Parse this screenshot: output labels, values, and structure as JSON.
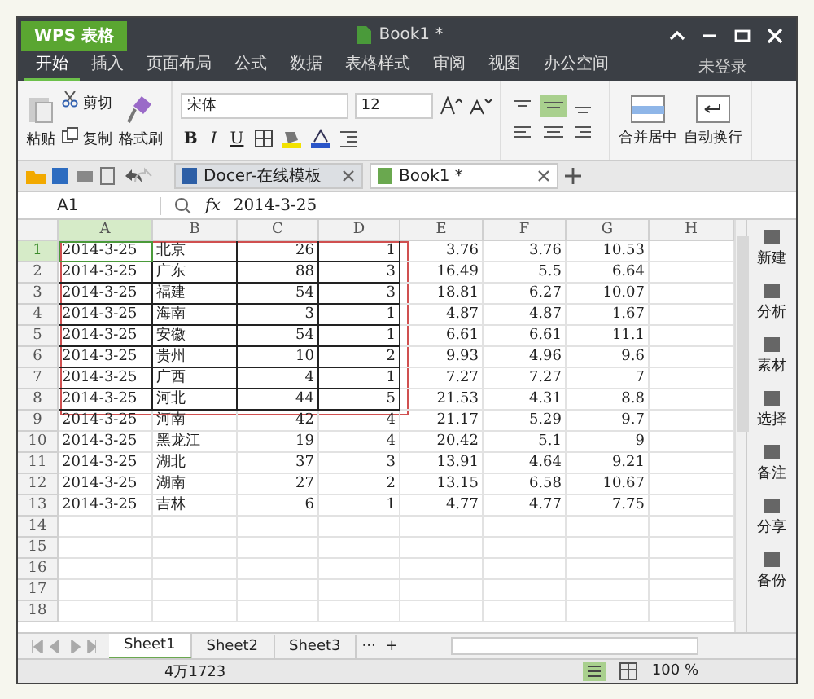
{
  "window": {
    "app_button": "WPS 表格",
    "title": "Book1 *"
  },
  "menu": [
    {
      "label": "开始",
      "selected": true
    },
    {
      "label": "插入",
      "selected": false
    },
    {
      "label": "页面布局",
      "selected": false
    },
    {
      "label": "公式",
      "selected": false
    },
    {
      "label": "数据",
      "selected": false
    },
    {
      "label": "表格样式",
      "selected": false
    },
    {
      "label": "审阅",
      "selected": false
    },
    {
      "label": "视图",
      "selected": false
    },
    {
      "label": "办公空间",
      "selected": false
    }
  ],
  "login": "未登录",
  "ribbon": {
    "paste": "粘贴",
    "cut": "剪切",
    "copy": "复制",
    "format_painter": "格式刷",
    "font": "宋体",
    "size": "12",
    "bold": "B",
    "italic": "I",
    "underline": "U",
    "merge": "合并居中",
    "wrap": "自动换行"
  },
  "doc_tabs": [
    {
      "label": "Docer-在线模板",
      "selected": false
    },
    {
      "label": "Book1 *",
      "selected": true
    }
  ],
  "formula_bar": {
    "cell_ref": "A1",
    "fx": "fx",
    "value": "2014-3-25"
  },
  "columns": [
    {
      "label": "A",
      "selected": true
    },
    {
      "label": "B",
      "selected": false
    },
    {
      "label": "C",
      "selected": false
    },
    {
      "label": "D",
      "selected": false
    },
    {
      "label": "E",
      "selected": false
    },
    {
      "label": "F",
      "selected": false
    },
    {
      "label": "G",
      "selected": false
    },
    {
      "label": "H",
      "selected": false
    }
  ],
  "rows": [
    {
      "num": "1",
      "selected": true,
      "bordered": true,
      "cells": [
        "2014-3-25",
        "北京",
        "26",
        "1",
        "3.76",
        "3.76",
        "10.53"
      ]
    },
    {
      "num": "2",
      "selected": false,
      "bordered": true,
      "cells": [
        "2014-3-25",
        "广东",
        "88",
        "3",
        "16.49",
        "5.5",
        "6.64"
      ]
    },
    {
      "num": "3",
      "selected": false,
      "bordered": true,
      "cells": [
        "2014-3-25",
        "福建",
        "54",
        "3",
        "18.81",
        "6.27",
        "10.07"
      ]
    },
    {
      "num": "4",
      "selected": false,
      "bordered": true,
      "cells": [
        "2014-3-25",
        "海南",
        "3",
        "1",
        "4.87",
        "4.87",
        "1.67"
      ]
    },
    {
      "num": "5",
      "selected": false,
      "bordered": true,
      "cells": [
        "2014-3-25",
        "安徽",
        "54",
        "1",
        "6.61",
        "6.61",
        "11.1"
      ]
    },
    {
      "num": "6",
      "selected": false,
      "bordered": true,
      "cells": [
        "2014-3-25",
        "贵州",
        "10",
        "2",
        "9.93",
        "4.96",
        "9.6"
      ]
    },
    {
      "num": "7",
      "selected": false,
      "bordered": true,
      "cells": [
        "2014-3-25",
        "广西",
        "4",
        "1",
        "7.27",
        "7.27",
        "7"
      ]
    },
    {
      "num": "8",
      "selected": false,
      "bordered": true,
      "cells": [
        "2014-3-25",
        "河北",
        "44",
        "5",
        "21.53",
        "4.31",
        "8.8"
      ]
    },
    {
      "num": "9",
      "selected": false,
      "bordered": false,
      "cells": [
        "2014-3-25",
        "河南",
        "42",
        "4",
        "21.17",
        "5.29",
        "9.7"
      ]
    },
    {
      "num": "10",
      "selected": false,
      "bordered": false,
      "cells": [
        "2014-3-25",
        "黑龙江",
        "19",
        "4",
        "20.42",
        "5.1",
        "9"
      ]
    },
    {
      "num": "11",
      "selected": false,
      "bordered": false,
      "cells": [
        "2014-3-25",
        "湖北",
        "37",
        "3",
        "13.91",
        "4.64",
        "9.21"
      ]
    },
    {
      "num": "12",
      "selected": false,
      "bordered": false,
      "cells": [
        "2014-3-25",
        "湖南",
        "27",
        "2",
        "13.15",
        "6.58",
        "10.67"
      ]
    },
    {
      "num": "13",
      "selected": false,
      "bordered": false,
      "cells": [
        "2014-3-25",
        "吉林",
        "6",
        "1",
        "4.77",
        "4.77",
        "7.75"
      ]
    },
    {
      "num": "14",
      "selected": false,
      "bordered": false,
      "cells": []
    },
    {
      "num": "15",
      "selected": false,
      "bordered": false,
      "cells": []
    },
    {
      "num": "16",
      "selected": false,
      "bordered": false,
      "cells": []
    },
    {
      "num": "17",
      "selected": false,
      "bordered": false,
      "cells": []
    },
    {
      "num": "18",
      "selected": false,
      "bordered": false,
      "cells": []
    }
  ],
  "sidebar": [
    "新建",
    "分析",
    "素材",
    "选择",
    "备注",
    "分享",
    "备份"
  ],
  "sheet_tabs": [
    {
      "label": "Sheet1",
      "selected": true
    },
    {
      "label": "Sheet2",
      "selected": false
    },
    {
      "label": "Sheet3",
      "selected": false
    }
  ],
  "sheet_more": "···",
  "sheet_add": "+",
  "status_bar": {
    "count": "4万1723",
    "zoom": "100 %"
  }
}
